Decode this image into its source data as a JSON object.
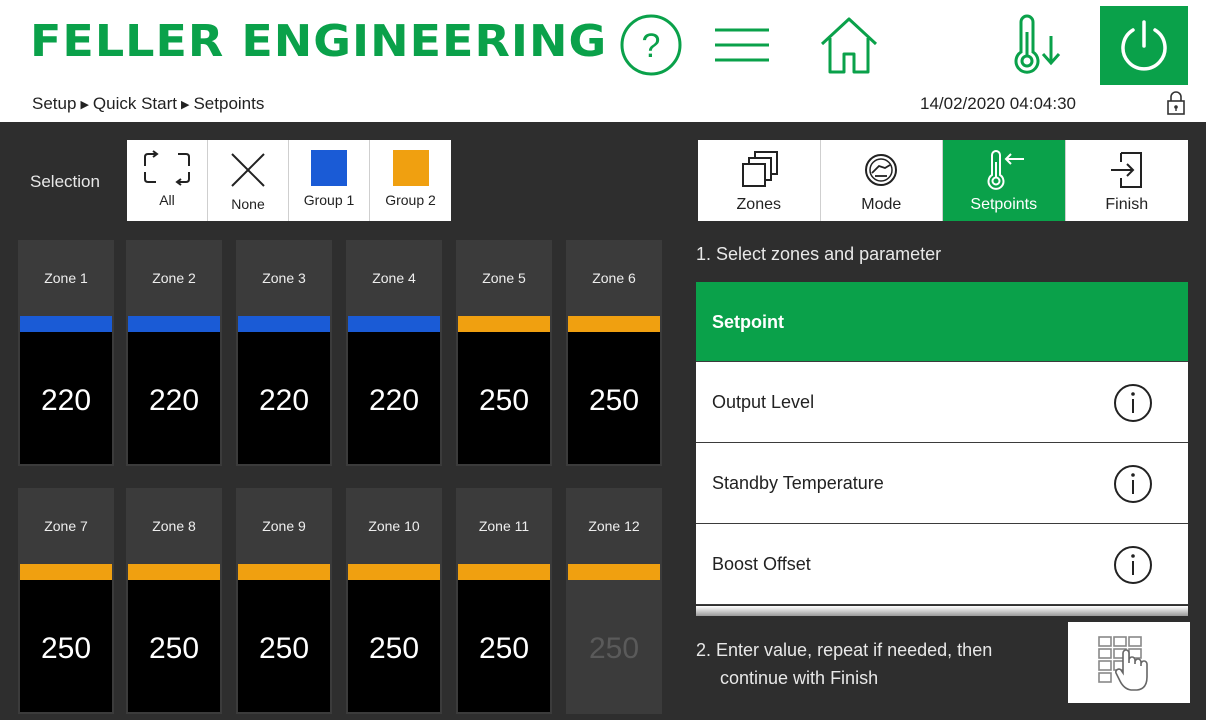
{
  "header": {
    "brand": "FELLER ENGINEERING",
    "icons": [
      "help-icon",
      "menu-icon",
      "home-icon",
      "thermometer-down-icon",
      "power-icon"
    ],
    "accent_color": "#0aa14a"
  },
  "breadcrumb": {
    "items": [
      "Setup",
      "Quick Start",
      "Setpoints"
    ]
  },
  "datetime": "14/02/2020 04:04:30",
  "selection": {
    "label": "Selection",
    "buttons": [
      {
        "label": "All",
        "icon": "select-all-icon"
      },
      {
        "label": "None",
        "icon": "close-icon"
      },
      {
        "label": "Group 1",
        "color": "#1a5bd6"
      },
      {
        "label": "Group 2",
        "color": "#f0a010"
      }
    ]
  },
  "zones": [
    {
      "name": "Zone 1",
      "value": "220",
      "group_color": "#1a5bd6"
    },
    {
      "name": "Zone 2",
      "value": "220",
      "group_color": "#1a5bd6"
    },
    {
      "name": "Zone 3",
      "value": "220",
      "group_color": "#1a5bd6"
    },
    {
      "name": "Zone 4",
      "value": "220",
      "group_color": "#1a5bd6"
    },
    {
      "name": "Zone 5",
      "value": "250",
      "group_color": "#f0a010"
    },
    {
      "name": "Zone 6",
      "value": "250",
      "group_color": "#f0a010"
    },
    {
      "name": "Zone 7",
      "value": "250",
      "group_color": "#f0a010"
    },
    {
      "name": "Zone 8",
      "value": "250",
      "group_color": "#f0a010"
    },
    {
      "name": "Zone 9",
      "value": "250",
      "group_color": "#f0a010"
    },
    {
      "name": "Zone 10",
      "value": "250",
      "group_color": "#f0a010"
    },
    {
      "name": "Zone 11",
      "value": "250",
      "group_color": "#f0a010"
    },
    {
      "name": "Zone 12",
      "value": "250",
      "group_color": "#f0a010",
      "disabled": true
    }
  ],
  "wizard": {
    "tabs": [
      {
        "label": "Zones",
        "icon": "zones-icon"
      },
      {
        "label": "Mode",
        "icon": "mode-icon"
      },
      {
        "label": "Setpoints",
        "icon": "setpoints-icon",
        "active": true
      },
      {
        "label": "Finish",
        "icon": "finish-icon"
      }
    ],
    "step1": "1. Select zones and parameter",
    "parameters": [
      {
        "label": "Setpoint",
        "active": true
      },
      {
        "label": "Output Level"
      },
      {
        "label": "Standby Temperature"
      },
      {
        "label": "Boost Offset"
      }
    ],
    "step2_line1": "2. Enter value, repeat if needed, then",
    "step2_line2": "continue with Finish"
  }
}
